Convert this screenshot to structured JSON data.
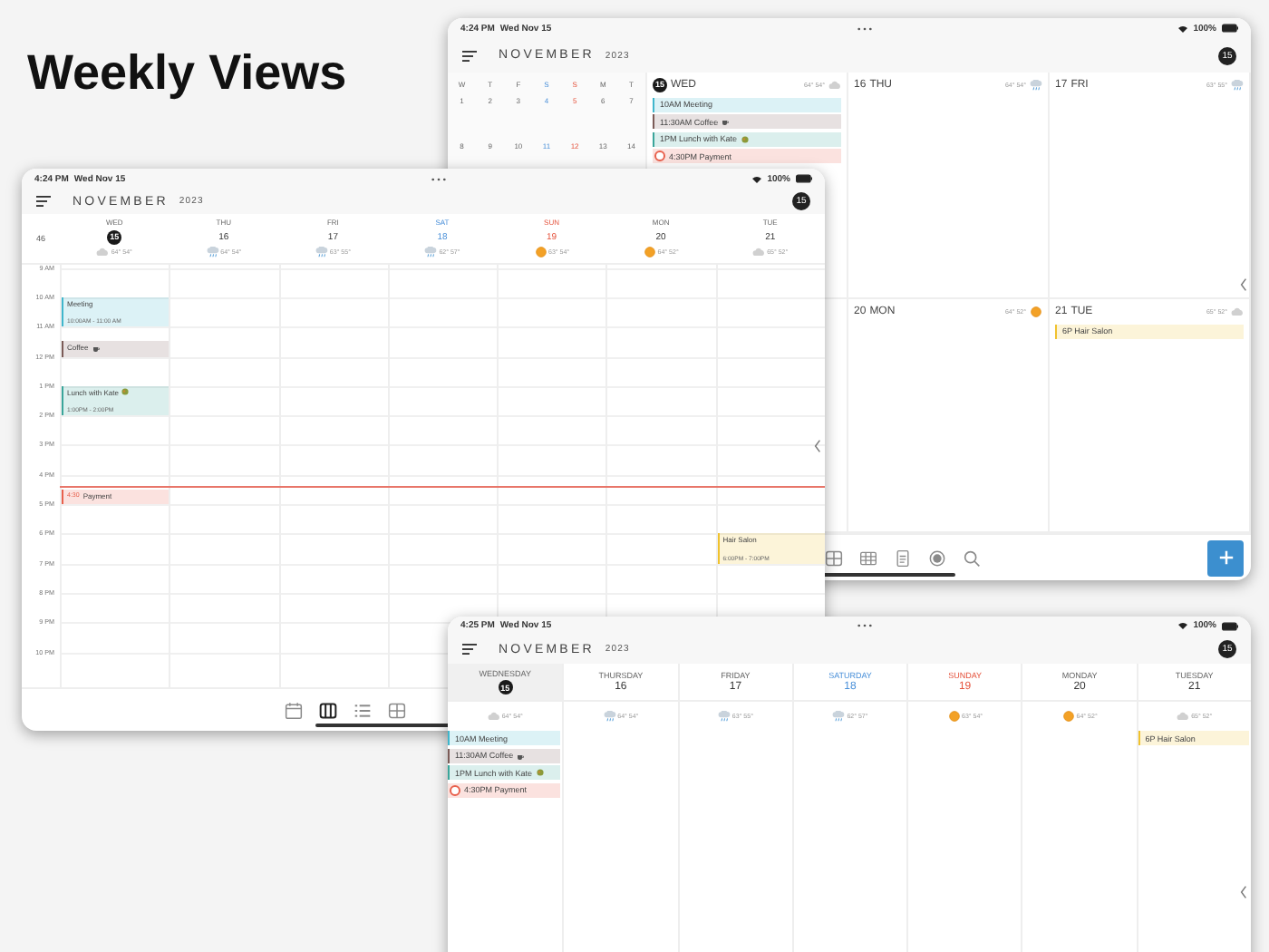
{
  "headline": "Weekly Views",
  "screens": [
    {
      "kind": "split",
      "status": {
        "time": "4:24 PM",
        "date": "Wed Nov 15",
        "battery": "100%"
      },
      "header": {
        "month": "NOVEMBER",
        "year": "2023",
        "today": "15"
      },
      "mini_calendar": {
        "weekdays": [
          {
            "label": "W",
            "kind": "weekday"
          },
          {
            "label": "T",
            "kind": "weekday"
          },
          {
            "label": "F",
            "kind": "weekday"
          },
          {
            "label": "S",
            "kind": "saturday"
          },
          {
            "label": "S",
            "kind": "sunday"
          },
          {
            "label": "M",
            "kind": "weekday"
          },
          {
            "label": "T",
            "kind": "weekday"
          }
        ],
        "weeks": [
          [
            "1",
            "2",
            "3",
            "4",
            "5",
            "6",
            "7"
          ],
          [
            "8",
            "9",
            "10",
            "11",
            "12",
            "13",
            "14"
          ]
        ]
      },
      "days": [
        {
          "date": "15",
          "name": "WED",
          "today": true,
          "weather": {
            "kind": "cloudy",
            "temps": "64° 54°"
          },
          "events": [
            {
              "kind": "event",
              "time": "10AM",
              "title": "Meeting",
              "color": "#3fb6cc"
            },
            {
              "kind": "coffee",
              "time": "11:30AM",
              "title": "Coffee",
              "color": "#7b5b57"
            },
            {
              "kind": "meal",
              "time": "1PM",
              "title": "Lunch with Kate",
              "color": "#3aa59a"
            },
            {
              "kind": "reminder",
              "time": "4:30PM",
              "title": "Payment",
              "color": "#e8604c"
            }
          ]
        },
        {
          "date": "16",
          "name": "THU",
          "today": false,
          "weather": {
            "kind": "rain",
            "temps": "64° 54°"
          }
        },
        {
          "date": "17",
          "name": "FRI",
          "today": false,
          "weather": {
            "kind": "rain",
            "temps": "63° 55°"
          }
        },
        {
          "date": "20",
          "name": "MON",
          "today": false,
          "weather": {
            "kind": "sunny",
            "temps": "64° 52°"
          }
        },
        {
          "date": "21",
          "name": "TUE",
          "today": false,
          "weather": {
            "kind": "cloudy",
            "temps": "65° 52°"
          },
          "events": [
            {
              "kind": "event",
              "time": "6P",
              "title": "Hair Salon",
              "color": "#f0c22e"
            }
          ]
        }
      ],
      "toolbar": [
        {
          "kind": "grid",
          "selected": false
        },
        {
          "kind": "table",
          "selected": false
        },
        {
          "kind": "document",
          "selected": false
        },
        {
          "kind": "record",
          "selected": false
        },
        {
          "kind": "search",
          "selected": false
        }
      ]
    },
    {
      "kind": "timeline",
      "status": {
        "time": "4:24 PM",
        "date": "Wed Nov 15",
        "battery": "100%"
      },
      "header": {
        "month": "NOVEMBER",
        "year": "2023",
        "today": "15"
      },
      "week_number": "46",
      "hours": [
        "9 AM",
        "10 AM",
        "11 AM",
        "12 PM",
        "1 PM",
        "2 PM",
        "3 PM",
        "4 PM",
        "5 PM",
        "6 PM",
        "7 PM",
        "8 PM",
        "9 PM",
        "10 PM"
      ],
      "days": [
        {
          "name": "WED",
          "date": "15",
          "kind": "weekday",
          "today": true,
          "weather": {
            "kind": "cloudy",
            "temps": "64° 54°"
          },
          "events": [
            {
              "kind": "event",
              "title": "Meeting",
              "range": "10:00AM - 11:00 AM",
              "color": "#3fb6cc"
            },
            {
              "kind": "coffee",
              "title": "Coffee",
              "color": "#7b5b57"
            },
            {
              "kind": "meal",
              "title": "Lunch with Kate",
              "range": "1:00PM - 2:00PM",
              "color": "#3aa59a"
            },
            {
              "kind": "reminder",
              "time": "4:30",
              "title": "Payment",
              "color": "#e8604c"
            }
          ]
        },
        {
          "name": "THU",
          "date": "16",
          "kind": "weekday",
          "today": false,
          "weather": {
            "kind": "rain",
            "temps": "64° 54°"
          }
        },
        {
          "name": "FRI",
          "date": "17",
          "kind": "weekday",
          "today": false,
          "weather": {
            "kind": "rain",
            "temps": "63° 55°"
          }
        },
        {
          "name": "SAT",
          "date": "18",
          "kind": "saturday",
          "today": false,
          "weather": {
            "kind": "rain",
            "temps": "62° 57°"
          }
        },
        {
          "name": "SUN",
          "date": "19",
          "kind": "sunday",
          "today": false,
          "weather": {
            "kind": "sunny",
            "temps": "63° 54°"
          }
        },
        {
          "name": "MON",
          "date": "20",
          "kind": "weekday",
          "today": false,
          "weather": {
            "kind": "sunny",
            "temps": "64° 52°"
          }
        },
        {
          "name": "TUE",
          "date": "21",
          "kind": "weekday",
          "today": false,
          "weather": {
            "kind": "cloudy",
            "temps": "65° 52°"
          },
          "events": [
            {
              "kind": "event",
              "title": "Hair Salon",
              "range": "6:00PM - 7:00PM",
              "color": "#f0c22e"
            }
          ]
        }
      ],
      "toolbar": [
        {
          "kind": "calendar",
          "selected": false
        },
        {
          "kind": "columns",
          "selected": true
        },
        {
          "kind": "list",
          "selected": false
        },
        {
          "kind": "grid",
          "selected": false
        }
      ]
    },
    {
      "kind": "columns",
      "status": {
        "time": "4:25 PM",
        "date": "Wed Nov 15",
        "battery": "100%"
      },
      "header": {
        "month": "NOVEMBER",
        "year": "2023",
        "today": "15"
      },
      "days": [
        {
          "name": "WEDNESDAY",
          "date": "15",
          "kind": "weekday",
          "today": true,
          "weather": {
            "kind": "cloudy",
            "temps": "64° 54°"
          },
          "events": [
            {
              "kind": "event",
              "time": "10AM",
              "title": "Meeting",
              "color": "#3fb6cc"
            },
            {
              "kind": "coffee",
              "time": "11:30AM",
              "title": "Coffee",
              "color": "#7b5b57"
            },
            {
              "kind": "meal",
              "time": "1PM",
              "title": "Lunch with Kate",
              "color": "#3aa59a"
            },
            {
              "kind": "reminder",
              "time": "4:30PM",
              "title": "Payment",
              "color": "#e8604c"
            }
          ]
        },
        {
          "name": "THURSDAY",
          "date": "16",
          "kind": "weekday",
          "today": false,
          "weather": {
            "kind": "rain",
            "temps": "64° 54°"
          }
        },
        {
          "name": "FRIDAY",
          "date": "17",
          "kind": "weekday",
          "today": false,
          "weather": {
            "kind": "rain",
            "temps": "63° 55°"
          }
        },
        {
          "name": "SATURDAY",
          "date": "18",
          "kind": "saturday",
          "today": false,
          "weather": {
            "kind": "rain",
            "temps": "62° 57°"
          }
        },
        {
          "name": "SUNDAY",
          "date": "19",
          "kind": "sunday",
          "today": false,
          "weather": {
            "kind": "sunny",
            "temps": "63° 54°"
          }
        },
        {
          "name": "MONDAY",
          "date": "20",
          "kind": "weekday",
          "today": false,
          "weather": {
            "kind": "sunny",
            "temps": "64° 52°"
          }
        },
        {
          "name": "TUESDAY",
          "date": "21",
          "kind": "weekday",
          "today": false,
          "weather": {
            "kind": "cloudy",
            "temps": "65° 52°"
          },
          "events": [
            {
              "kind": "event",
              "time": "6P",
              "title": "Hair Salon",
              "color": "#f0c22e"
            }
          ]
        }
      ]
    }
  ]
}
